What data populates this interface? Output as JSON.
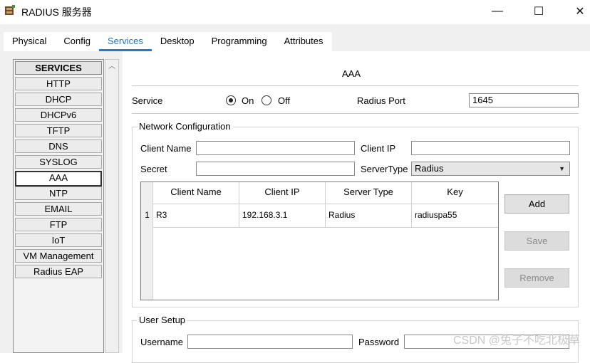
{
  "window": {
    "title": "RADIUS 服务器",
    "minimize": "—",
    "maximize": "☐",
    "close": "✕"
  },
  "tabs": [
    "Physical",
    "Config",
    "Services",
    "Desktop",
    "Programming",
    "Attributes"
  ],
  "sidebar": {
    "header": "SERVICES",
    "items": [
      "HTTP",
      "DHCP",
      "DHCPv6",
      "TFTP",
      "DNS",
      "SYSLOG",
      "AAA",
      "NTP",
      "EMAIL",
      "FTP",
      "IoT",
      "VM Management",
      "Radius EAP"
    ],
    "active": "AAA"
  },
  "aaa": {
    "title": "AAA",
    "service_label": "Service",
    "on_label": "On",
    "off_label": "Off",
    "radius_port_label": "Radius Port",
    "radius_port_value": "1645",
    "network": {
      "legend": "Network Configuration",
      "client_name_label": "Client Name",
      "client_name_value": "",
      "client_ip_label": "Client IP",
      "client_ip_value": "",
      "secret_label": "Secret",
      "secret_value": "",
      "server_type_label": "ServerType",
      "server_type_value": "Radius",
      "columns": [
        "Client Name",
        "Client IP",
        "Server Type",
        "Key"
      ],
      "rows": [
        {
          "num": "1",
          "client_name": "R3",
          "client_ip": "192.168.3.1",
          "server_type": "Radius",
          "key": "radiuspa55"
        }
      ],
      "add": "Add",
      "save": "Save",
      "remove": "Remove"
    },
    "user": {
      "legend": "User Setup",
      "username_label": "Username",
      "username_value": "",
      "password_label": "Password",
      "password_value": ""
    }
  },
  "watermark": "CSDN @兔子不吃北极草"
}
